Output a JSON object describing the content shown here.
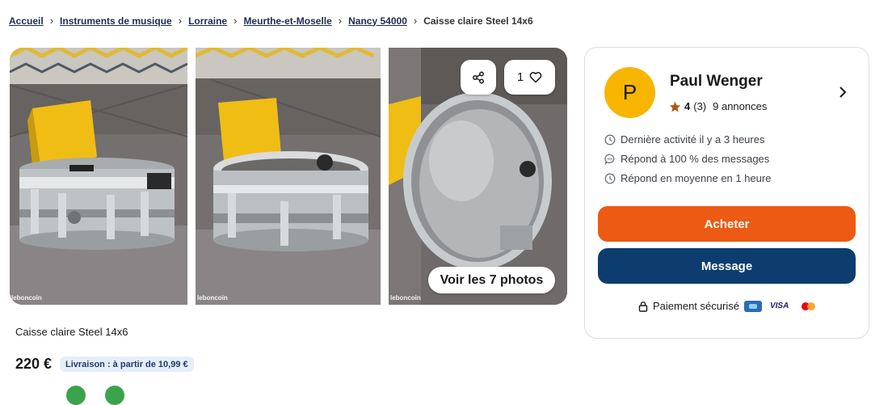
{
  "breadcrumb": {
    "items": [
      "Accueil",
      "Instruments de musique",
      "Lorraine",
      "Meurthe-et-Moselle",
      "Nancy 54000"
    ],
    "current": "Caisse claire Steel 14x6"
  },
  "gallery": {
    "watermark": "leboncoin",
    "like_count": "1",
    "view_photos_label": "Voir les 7 photos"
  },
  "ad": {
    "title": "Caisse claire Steel 14x6",
    "price": "220 €",
    "shipping": "Livraison : à partir de 10,99 €"
  },
  "seller": {
    "initial": "P",
    "name": "Paul Wenger",
    "rating": "4",
    "reviews": "(3)",
    "listings": "9 annonces",
    "last_activity": "Dernière activité il y a 3 heures",
    "response_rate": "Répond à 100 % des messages",
    "response_time": "Répond en moyenne en 1 heure"
  },
  "actions": {
    "buy_label": "Acheter",
    "message_label": "Message"
  },
  "payment": {
    "label": "Paiement sécurisé",
    "visa": "VISA"
  },
  "colors": {
    "buy": "#ec5a13",
    "message": "#0c3d6e",
    "avatar": "#f7b500"
  }
}
